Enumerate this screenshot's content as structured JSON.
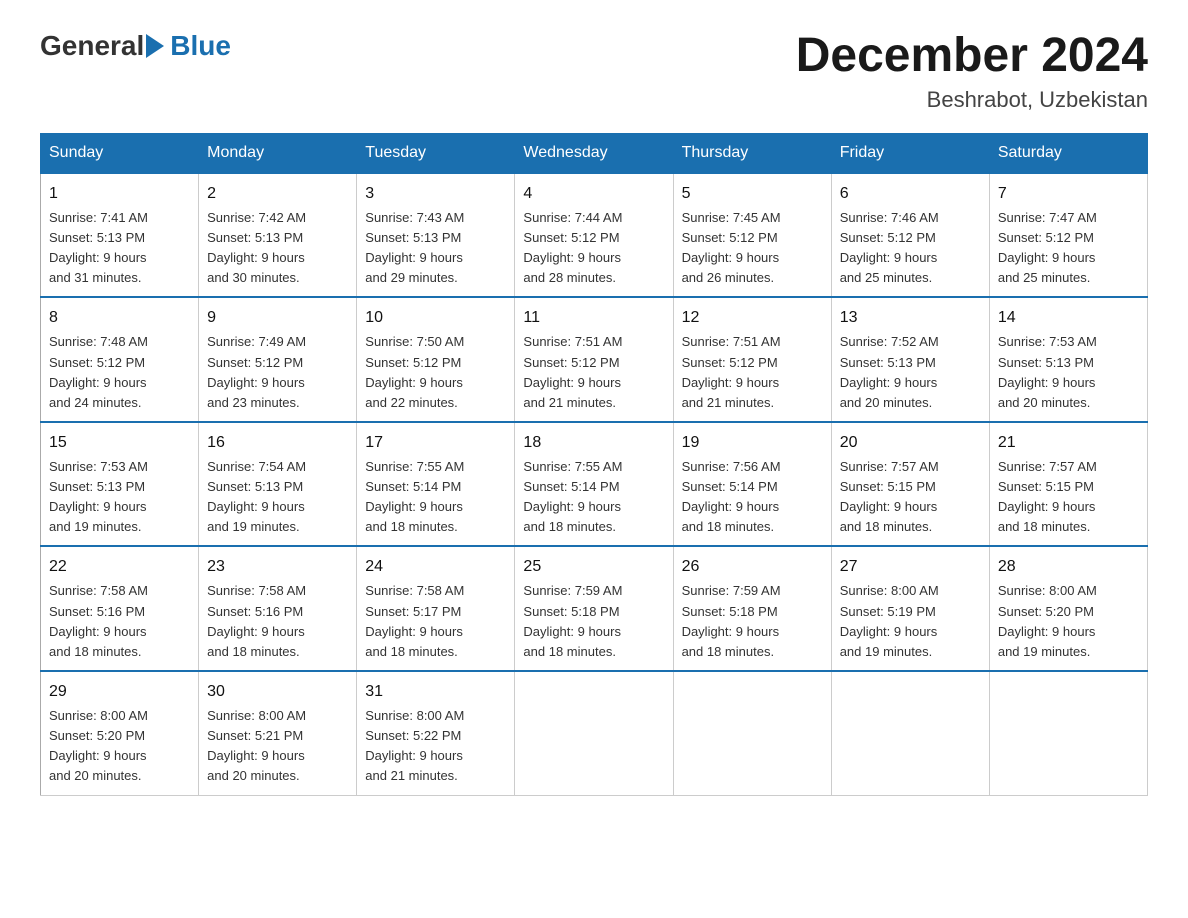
{
  "logo": {
    "general": "General",
    "blue": "Blue"
  },
  "title": "December 2024",
  "location": "Beshrabot, Uzbekistan",
  "weekdays": [
    "Sunday",
    "Monday",
    "Tuesday",
    "Wednesday",
    "Thursday",
    "Friday",
    "Saturday"
  ],
  "weeks": [
    [
      {
        "day": "1",
        "sunrise": "7:41 AM",
        "sunset": "5:13 PM",
        "daylight": "9 hours and 31 minutes."
      },
      {
        "day": "2",
        "sunrise": "7:42 AM",
        "sunset": "5:13 PM",
        "daylight": "9 hours and 30 minutes."
      },
      {
        "day": "3",
        "sunrise": "7:43 AM",
        "sunset": "5:13 PM",
        "daylight": "9 hours and 29 minutes."
      },
      {
        "day": "4",
        "sunrise": "7:44 AM",
        "sunset": "5:12 PM",
        "daylight": "9 hours and 28 minutes."
      },
      {
        "day": "5",
        "sunrise": "7:45 AM",
        "sunset": "5:12 PM",
        "daylight": "9 hours and 26 minutes."
      },
      {
        "day": "6",
        "sunrise": "7:46 AM",
        "sunset": "5:12 PM",
        "daylight": "9 hours and 25 minutes."
      },
      {
        "day": "7",
        "sunrise": "7:47 AM",
        "sunset": "5:12 PM",
        "daylight": "9 hours and 25 minutes."
      }
    ],
    [
      {
        "day": "8",
        "sunrise": "7:48 AM",
        "sunset": "5:12 PM",
        "daylight": "9 hours and 24 minutes."
      },
      {
        "day": "9",
        "sunrise": "7:49 AM",
        "sunset": "5:12 PM",
        "daylight": "9 hours and 23 minutes."
      },
      {
        "day": "10",
        "sunrise": "7:50 AM",
        "sunset": "5:12 PM",
        "daylight": "9 hours and 22 minutes."
      },
      {
        "day": "11",
        "sunrise": "7:51 AM",
        "sunset": "5:12 PM",
        "daylight": "9 hours and 21 minutes."
      },
      {
        "day": "12",
        "sunrise": "7:51 AM",
        "sunset": "5:12 PM",
        "daylight": "9 hours and 21 minutes."
      },
      {
        "day": "13",
        "sunrise": "7:52 AM",
        "sunset": "5:13 PM",
        "daylight": "9 hours and 20 minutes."
      },
      {
        "day": "14",
        "sunrise": "7:53 AM",
        "sunset": "5:13 PM",
        "daylight": "9 hours and 20 minutes."
      }
    ],
    [
      {
        "day": "15",
        "sunrise": "7:53 AM",
        "sunset": "5:13 PM",
        "daylight": "9 hours and 19 minutes."
      },
      {
        "day": "16",
        "sunrise": "7:54 AM",
        "sunset": "5:13 PM",
        "daylight": "9 hours and 19 minutes."
      },
      {
        "day": "17",
        "sunrise": "7:55 AM",
        "sunset": "5:14 PM",
        "daylight": "9 hours and 18 minutes."
      },
      {
        "day": "18",
        "sunrise": "7:55 AM",
        "sunset": "5:14 PM",
        "daylight": "9 hours and 18 minutes."
      },
      {
        "day": "19",
        "sunrise": "7:56 AM",
        "sunset": "5:14 PM",
        "daylight": "9 hours and 18 minutes."
      },
      {
        "day": "20",
        "sunrise": "7:57 AM",
        "sunset": "5:15 PM",
        "daylight": "9 hours and 18 minutes."
      },
      {
        "day": "21",
        "sunrise": "7:57 AM",
        "sunset": "5:15 PM",
        "daylight": "9 hours and 18 minutes."
      }
    ],
    [
      {
        "day": "22",
        "sunrise": "7:58 AM",
        "sunset": "5:16 PM",
        "daylight": "9 hours and 18 minutes."
      },
      {
        "day": "23",
        "sunrise": "7:58 AM",
        "sunset": "5:16 PM",
        "daylight": "9 hours and 18 minutes."
      },
      {
        "day": "24",
        "sunrise": "7:58 AM",
        "sunset": "5:17 PM",
        "daylight": "9 hours and 18 minutes."
      },
      {
        "day": "25",
        "sunrise": "7:59 AM",
        "sunset": "5:18 PM",
        "daylight": "9 hours and 18 minutes."
      },
      {
        "day": "26",
        "sunrise": "7:59 AM",
        "sunset": "5:18 PM",
        "daylight": "9 hours and 18 minutes."
      },
      {
        "day": "27",
        "sunrise": "8:00 AM",
        "sunset": "5:19 PM",
        "daylight": "9 hours and 19 minutes."
      },
      {
        "day": "28",
        "sunrise": "8:00 AM",
        "sunset": "5:20 PM",
        "daylight": "9 hours and 19 minutes."
      }
    ],
    [
      {
        "day": "29",
        "sunrise": "8:00 AM",
        "sunset": "5:20 PM",
        "daylight": "9 hours and 20 minutes."
      },
      {
        "day": "30",
        "sunrise": "8:00 AM",
        "sunset": "5:21 PM",
        "daylight": "9 hours and 20 minutes."
      },
      {
        "day": "31",
        "sunrise": "8:00 AM",
        "sunset": "5:22 PM",
        "daylight": "9 hours and 21 minutes."
      },
      null,
      null,
      null,
      null
    ]
  ],
  "labels": {
    "sunrise": "Sunrise:",
    "sunset": "Sunset:",
    "daylight": "Daylight:"
  }
}
